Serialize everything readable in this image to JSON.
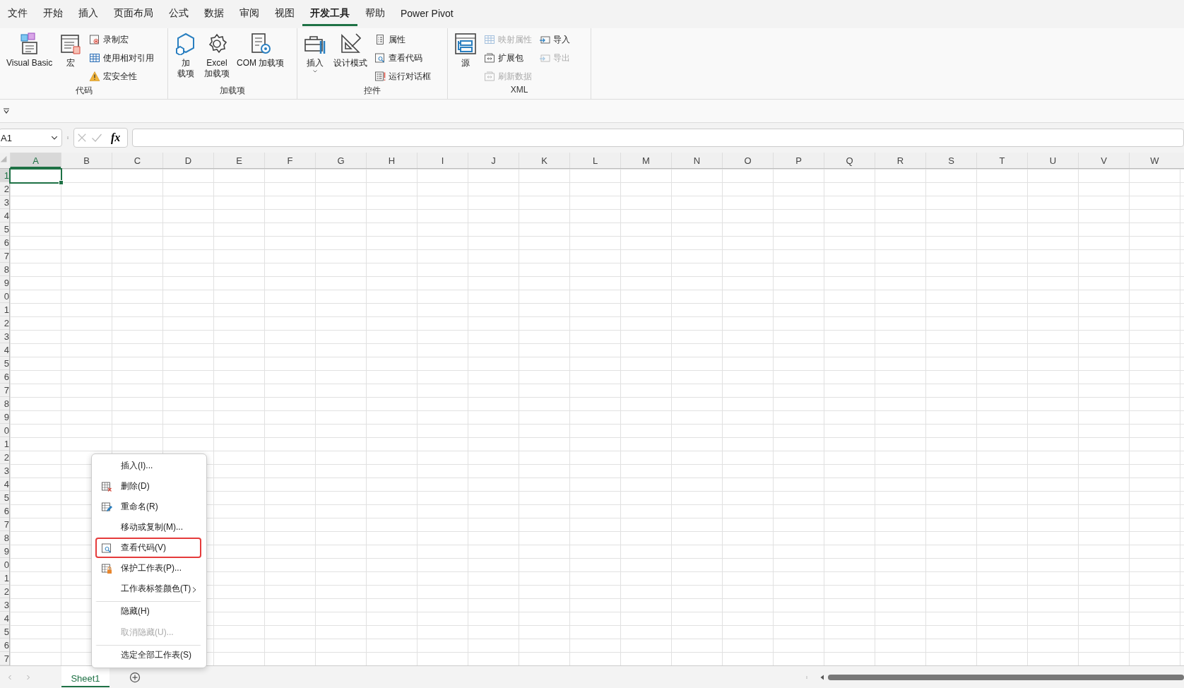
{
  "menu_tabs": [
    {
      "label": "文件",
      "selected": false
    },
    {
      "label": "开始",
      "selected": false
    },
    {
      "label": "插入",
      "selected": false
    },
    {
      "label": "页面布局",
      "selected": false
    },
    {
      "label": "公式",
      "selected": false
    },
    {
      "label": "数据",
      "selected": false
    },
    {
      "label": "审阅",
      "selected": false
    },
    {
      "label": "视图",
      "selected": false
    },
    {
      "label": "开发工具",
      "selected": true
    },
    {
      "label": "帮助",
      "selected": false
    },
    {
      "label": "Power Pivot",
      "selected": false
    }
  ],
  "ribbon": {
    "groups": [
      {
        "label": "代码",
        "items": [
          {
            "kind": "large",
            "lines": [
              "Visual Basic"
            ],
            "disabled": false
          },
          {
            "kind": "large",
            "lines": [
              "宏"
            ],
            "disabled": false
          },
          {
            "kind": "small",
            "lines": [
              "录制宏"
            ],
            "disabled": false
          },
          {
            "kind": "small",
            "lines": [
              "使用相对引用"
            ],
            "disabled": false
          },
          {
            "kind": "small",
            "lines": [
              "宏安全性"
            ],
            "disabled": false
          }
        ]
      },
      {
        "label": "加载项",
        "items": [
          {
            "kind": "large",
            "lines": [
              "加",
              "载项"
            ],
            "disabled": false
          },
          {
            "kind": "large",
            "lines": [
              "Excel",
              "加载项"
            ],
            "disabled": false
          },
          {
            "kind": "large",
            "lines": [
              "COM 加载项"
            ],
            "disabled": false
          }
        ]
      },
      {
        "label": "控件",
        "items": [
          {
            "kind": "large",
            "lines": [
              "插入"
            ],
            "dropdown": true,
            "disabled": false
          },
          {
            "kind": "large",
            "lines": [
              "设计模式"
            ],
            "disabled": false
          },
          {
            "kind": "small",
            "lines": [
              "属性"
            ],
            "disabled": false
          },
          {
            "kind": "small",
            "lines": [
              "查看代码"
            ],
            "disabled": false
          },
          {
            "kind": "small",
            "lines": [
              "运行对话框"
            ],
            "disabled": false
          }
        ]
      },
      {
        "label": "XML",
        "items": [
          {
            "kind": "large",
            "lines": [
              "源"
            ],
            "disabled": false
          },
          {
            "kind": "small",
            "lines": [
              "映射属性"
            ],
            "disabled": true
          },
          {
            "kind": "small",
            "lines": [
              "扩展包"
            ],
            "disabled": false
          },
          {
            "kind": "small",
            "lines": [
              "刷新数据"
            ],
            "disabled": true
          },
          {
            "kind": "small",
            "lines": [
              "导入"
            ],
            "disabled": false
          },
          {
            "kind": "small",
            "lines": [
              "导出"
            ],
            "disabled": true
          }
        ]
      }
    ]
  },
  "formula_bar": {
    "name_box": "A1",
    "fx": "fx"
  },
  "columns": [
    {
      "label": "A",
      "selected": true
    },
    {
      "label": "B",
      "selected": false
    },
    {
      "label": "C",
      "selected": false
    },
    {
      "label": "D",
      "selected": false
    },
    {
      "label": "E",
      "selected": false
    },
    {
      "label": "F",
      "selected": false
    },
    {
      "label": "G",
      "selected": false
    },
    {
      "label": "H",
      "selected": false
    },
    {
      "label": "I",
      "selected": false
    },
    {
      "label": "J",
      "selected": false
    },
    {
      "label": "K",
      "selected": false
    },
    {
      "label": "L",
      "selected": false
    },
    {
      "label": "M",
      "selected": false
    },
    {
      "label": "N",
      "selected": false
    },
    {
      "label": "O",
      "selected": false
    },
    {
      "label": "P",
      "selected": false
    },
    {
      "label": "Q",
      "selected": false
    },
    {
      "label": "R",
      "selected": false
    },
    {
      "label": "S",
      "selected": false
    },
    {
      "label": "T",
      "selected": false
    },
    {
      "label": "U",
      "selected": false
    },
    {
      "label": "V",
      "selected": false
    },
    {
      "label": "W",
      "selected": false
    }
  ],
  "rows": [
    {
      "label": "1",
      "selected": true
    },
    {
      "label": "2",
      "selected": false
    },
    {
      "label": "3",
      "selected": false
    },
    {
      "label": "4",
      "selected": false
    },
    {
      "label": "5",
      "selected": false
    },
    {
      "label": "6",
      "selected": false
    },
    {
      "label": "7",
      "selected": false
    },
    {
      "label": "8",
      "selected": false
    },
    {
      "label": "9",
      "selected": false
    },
    {
      "label": "0",
      "selected": false
    },
    {
      "label": "1",
      "selected": false
    },
    {
      "label": "2",
      "selected": false
    },
    {
      "label": "3",
      "selected": false
    },
    {
      "label": "4",
      "selected": false
    },
    {
      "label": "5",
      "selected": false
    },
    {
      "label": "6",
      "selected": false
    },
    {
      "label": "7",
      "selected": false
    },
    {
      "label": "8",
      "selected": false
    },
    {
      "label": "9",
      "selected": false
    },
    {
      "label": "0",
      "selected": false
    },
    {
      "label": "1",
      "selected": false
    },
    {
      "label": "2",
      "selected": false
    },
    {
      "label": "3",
      "selected": false
    },
    {
      "label": "4",
      "selected": false
    },
    {
      "label": "5",
      "selected": false
    },
    {
      "label": "6",
      "selected": false
    },
    {
      "label": "7",
      "selected": false
    },
    {
      "label": "8",
      "selected": false
    },
    {
      "label": "9",
      "selected": false
    },
    {
      "label": "0",
      "selected": false
    },
    {
      "label": "1",
      "selected": false
    },
    {
      "label": "2",
      "selected": false
    },
    {
      "label": "3",
      "selected": false
    },
    {
      "label": "4",
      "selected": false
    },
    {
      "label": "5",
      "selected": false
    },
    {
      "label": "6",
      "selected": false
    },
    {
      "label": "7",
      "selected": false
    }
  ],
  "context_menu": [
    {
      "label": "插入(I)...",
      "disabled": false,
      "highlighted": false,
      "submenu": false,
      "separator_before": false
    },
    {
      "label": "删除(D)",
      "disabled": false,
      "highlighted": false,
      "submenu": false,
      "separator_before": false
    },
    {
      "label": "重命名(R)",
      "disabled": false,
      "highlighted": false,
      "submenu": false,
      "separator_before": false
    },
    {
      "label": "移动或复制(M)...",
      "disabled": false,
      "highlighted": false,
      "submenu": false,
      "separator_before": false
    },
    {
      "label": "查看代码(V)",
      "disabled": false,
      "highlighted": true,
      "submenu": false,
      "separator_before": false
    },
    {
      "label": "保护工作表(P)...",
      "disabled": false,
      "highlighted": false,
      "submenu": false,
      "separator_before": false
    },
    {
      "label": "工作表标签颜色(T)",
      "disabled": false,
      "highlighted": false,
      "submenu": true,
      "separator_before": false
    },
    {
      "label": "隐藏(H)",
      "disabled": false,
      "highlighted": false,
      "submenu": false,
      "separator_before": true
    },
    {
      "label": "取消隐藏(U)...",
      "disabled": true,
      "highlighted": false,
      "submenu": false,
      "separator_before": false
    },
    {
      "label": "选定全部工作表(S)",
      "disabled": false,
      "highlighted": false,
      "submenu": false,
      "separator_before": true
    }
  ],
  "sheet_tabs": [
    {
      "label": "Sheet1",
      "selected": true
    }
  ]
}
